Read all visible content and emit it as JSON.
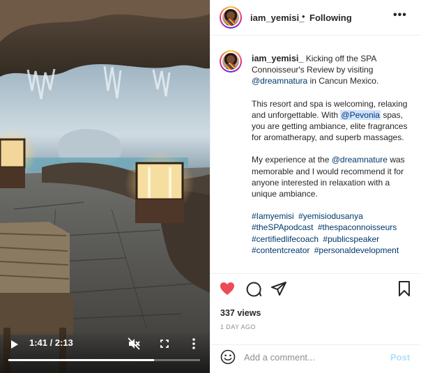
{
  "post": {
    "username": "iam_yemisi_",
    "follow_status": "Following",
    "more_icon": "more-icon"
  },
  "video": {
    "current_time": "1:41",
    "duration": "2:13",
    "time_display": "1:41 / 2:13",
    "progress_fraction": 0.76
  },
  "caption": {
    "intro_text": "Kicking off the SPA Connoisseur's Review by visiting",
    "mention_dreamnatura": "@dreamnatura",
    "intro_suffix": "in Cancun Mexico.",
    "p2_before": "This resort and spa is welcoming, relaxing and unforgettable. With",
    "mention_pevonia": "@Pevonia",
    "p2_after": "spas, you are getting ambiance, elite fragrances for aromatherapy, and superb massages.",
    "p3_before": "My experience at the",
    "mention_dreamnature": "@dreamnature",
    "p3_after": "was memorable and I would recommend it for anyone interested in relaxation with a unique ambiance.",
    "hashtags": [
      "#Iamyemisi",
      "#yemisiodusanya",
      "#theSPApodcast",
      "#thespaconnoisseurs",
      "#certifiedlifecoach",
      "#publicspeaker",
      "#contentcreator",
      "#personaldevelopment"
    ]
  },
  "stats": {
    "views": "337 views",
    "date": "1 DAY AGO"
  },
  "comment": {
    "placeholder": "Add a comment...",
    "post_label": "Post"
  },
  "colors": {
    "like": "#ed4956",
    "link": "#00376b",
    "mention_highlight": "#cfe3ff",
    "post_button": "#b2dffc"
  }
}
